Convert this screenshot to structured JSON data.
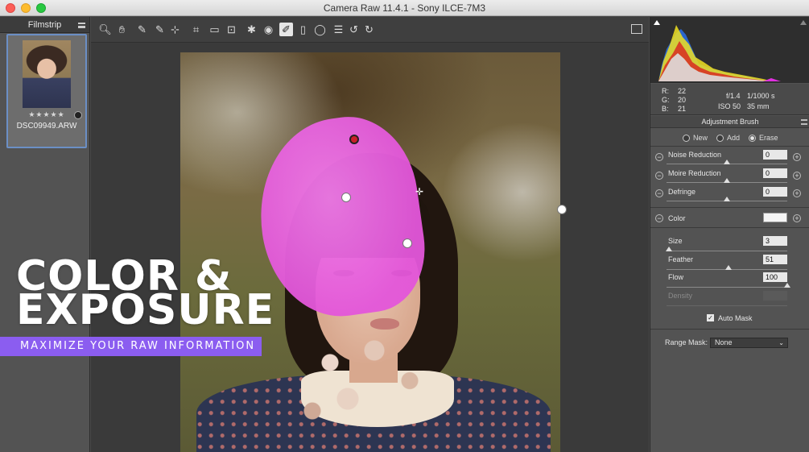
{
  "window": {
    "title": "Camera Raw 11.4.1  -  Sony ILCE-7M3"
  },
  "filmstrip": {
    "title": "Filmstrip",
    "rating": "★★★★★",
    "filename": "DSC09949.ARW"
  },
  "toolbar": {
    "tools": [
      {
        "name": "zoom-tool-icon",
        "glyph": "🔍︎"
      },
      {
        "name": "hand-tool-icon",
        "glyph": "✋︎"
      },
      {
        "name": "white-balance-tool-icon",
        "glyph": "✎"
      },
      {
        "name": "color-sampler-tool-icon",
        "glyph": "✎"
      },
      {
        "name": "targeted-adjustment-tool-icon",
        "glyph": "⊹"
      },
      {
        "name": "crop-tool-icon",
        "glyph": "⌗"
      },
      {
        "name": "straighten-tool-icon",
        "glyph": "▭"
      },
      {
        "name": "transform-tool-icon",
        "glyph": "⊡"
      },
      {
        "name": "spot-removal-tool-icon",
        "glyph": "✱"
      },
      {
        "name": "red-eye-tool-icon",
        "glyph": "◉"
      },
      {
        "name": "adjustment-brush-tool-icon",
        "glyph": "✐"
      },
      {
        "name": "graduated-filter-tool-icon",
        "glyph": "▯"
      },
      {
        "name": "radial-filter-tool-icon",
        "glyph": "◯"
      },
      {
        "name": "preferences-icon",
        "glyph": "☰"
      },
      {
        "name": "rotate-left-icon",
        "glyph": "↺"
      },
      {
        "name": "rotate-right-icon",
        "glyph": "↻"
      }
    ]
  },
  "overlay": {
    "title_line1": "COLOR &",
    "title_line2": "EXPOSURE",
    "subtitle": "MAXIMIZE YOUR RAW INFORMATION"
  },
  "readout": {
    "r_label": "R:",
    "r_value": "22",
    "g_label": "G:",
    "g_value": "20",
    "b_label": "B:",
    "b_value": "21",
    "aperture": "f/1.4",
    "shutter": "1/1000 s",
    "iso": "ISO 50",
    "focal": "35 mm"
  },
  "adjustment_brush": {
    "title": "Adjustment Brush",
    "modes": [
      {
        "label": "New",
        "selected": false
      },
      {
        "label": "Add",
        "selected": false
      },
      {
        "label": "Erase",
        "selected": true
      }
    ],
    "sliders": [
      {
        "label": "Noise Reduction",
        "value": "0",
        "pos": 0.5
      },
      {
        "label": "Moire Reduction",
        "value": "0",
        "pos": 0.5
      },
      {
        "label": "Defringe",
        "value": "0",
        "pos": 0.5
      }
    ],
    "color_label": "Color",
    "brush": [
      {
        "label": "Size",
        "value": "3",
        "pos": 0.02
      },
      {
        "label": "Feather",
        "value": "51",
        "pos": 0.51
      },
      {
        "label": "Flow",
        "value": "100",
        "pos": 1.0
      },
      {
        "label": "Density",
        "value": "",
        "pos": null
      }
    ],
    "auto_mask_label": "Auto Mask",
    "auto_mask_checked": true,
    "range_mask_label": "Range Mask:",
    "range_mask_value": "None"
  },
  "colors": {
    "mask_overlay": "#e356da",
    "brand_purple": "#8b5df0",
    "selection_blue": "#6b8fc5"
  }
}
